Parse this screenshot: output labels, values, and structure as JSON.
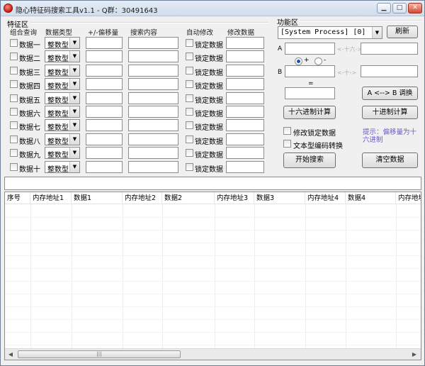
{
  "window": {
    "title": "隐心特征码搜索工具v1.1 - Q群：30491643",
    "min_label": "▁",
    "max_label": "□",
    "close_label": "✕"
  },
  "feature": {
    "section_label": "特征区",
    "headers": {
      "combine": "组合查询",
      "type": "数据类型",
      "offset": "+/-偏移量",
      "search": "搜索内容",
      "auto": "自动修改",
      "modify": "修改数据"
    },
    "rows": [
      {
        "label": "数据一",
        "type": "整数型",
        "lock": "锁定数据"
      },
      {
        "label": "数据二",
        "type": "整数型",
        "lock": "锁定数据"
      },
      {
        "label": "数据三",
        "type": "整数型",
        "lock": "锁定数据"
      },
      {
        "label": "数据四",
        "type": "整数型",
        "lock": "锁定数据"
      },
      {
        "label": "数据五",
        "type": "整数型",
        "lock": "锁定数据"
      },
      {
        "label": "数据六",
        "type": "整数型",
        "lock": "锁定数据"
      },
      {
        "label": "数据七",
        "type": "整数型",
        "lock": "锁定数据"
      },
      {
        "label": "数据八",
        "type": "整数型",
        "lock": "锁定数据"
      },
      {
        "label": "数据九",
        "type": "整数型",
        "lock": "锁定数据"
      },
      {
        "label": "数据十",
        "type": "整数型",
        "lock": "锁定数据"
      }
    ]
  },
  "function": {
    "section_label": "功能区",
    "process": "[System Process] [0]",
    "refresh": "刷新",
    "a_label": "A",
    "b_label": "B",
    "hex_arrow": "<-十六->",
    "dec_arrow": "<-十->",
    "radio_plus": "+",
    "radio_minus": "-",
    "equals": "=",
    "swap": "A <--> B 调换",
    "hex_calc": "十六进制计算",
    "dec_calc": "十进制计算",
    "modify_locked": "修改锁定数据",
    "text_convert": "文本型编码转换",
    "hint": "提示：偏移量为十六进制",
    "start_search": "开始搜索",
    "clear_data": "清空数据"
  },
  "table": {
    "columns": [
      "序号",
      "内存地址1",
      "数据1",
      "内存地址2",
      "数据2",
      "内存地址3",
      "数据3",
      "内存地址4",
      "数据4",
      "内存地址"
    ]
  },
  "scrollbar": {
    "left": "◀",
    "right": "▶",
    "thumb": "|||"
  }
}
